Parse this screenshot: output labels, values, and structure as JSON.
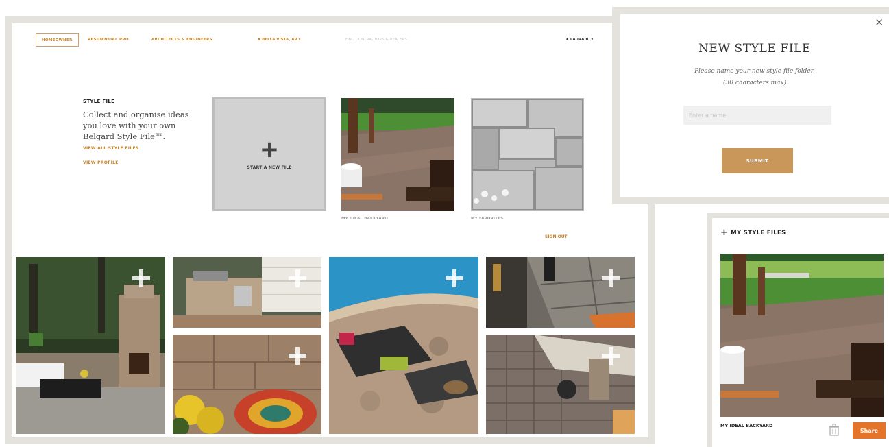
{
  "nav": {
    "tabs": [
      {
        "label": "HOMEOWNER"
      },
      {
        "label": "RESIDENTIAL PRO"
      },
      {
        "label": "ARCHITECTS & ENGINEERS"
      }
    ],
    "location": "BELLA VISTA, AR",
    "search_placeholder": "FIND CONTRACTORS & DEALERS",
    "user": "LAURA B."
  },
  "intro": {
    "heading": "STYLE FILE",
    "text": "Collect and organise ideas you love with your own Belgard Style File™.",
    "view_all": "VIEW ALL STYLE FILES",
    "view_profile": "VIEW PROFILE"
  },
  "new_file": {
    "label": "START A NEW FILE"
  },
  "files": [
    {
      "label": "MY IDEAL BACKYARD"
    },
    {
      "label": "MY FAVORITES"
    }
  ],
  "sign_out": "SIGN OUT",
  "modal": {
    "title": "NEW STYLE FILE",
    "subtitle_line1": "Please name your new style file folder.",
    "subtitle_line2": "(30 characters max)",
    "input_placeholder": "Enter a name",
    "submit": "SUBMIT",
    "close": "×"
  },
  "panel": {
    "header": "MY STYLE FILES",
    "file_label": "MY IDEAL BACKYARD",
    "share": "Share"
  },
  "colors": {
    "accent": "#c8852a",
    "submit": "#c9975a",
    "share": "#e3742a",
    "frame": "#e3e2dd"
  }
}
